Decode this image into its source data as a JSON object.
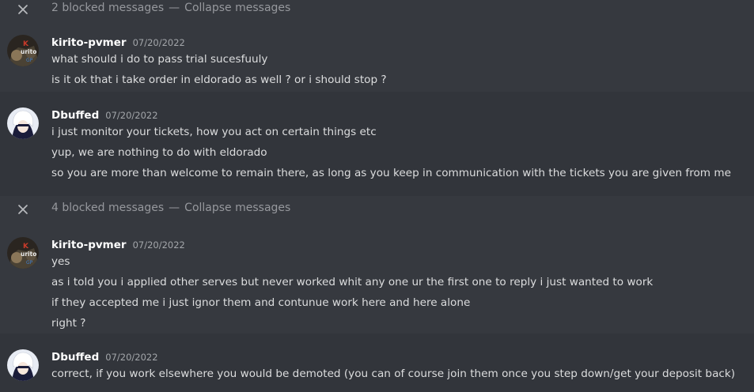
{
  "blocked_1": {
    "count_text": "2 blocked messages",
    "separator": "—",
    "collapse_label": "Collapse messages"
  },
  "group_1": {
    "username": "kirito-pvmer",
    "timestamp": "07/20/2022",
    "avatar_text": "K urito",
    "lines": [
      "what  should i do to pass trial sucesfuuly",
      "is it ok that i take order in eldorado as well ? or i should stop ?"
    ]
  },
  "group_2": {
    "username": "Dbuffed",
    "timestamp": "07/20/2022",
    "lines": [
      "i just monitor your tickets, how you act on certain things etc",
      "yup, we are nothing to do with eldorado",
      "so you are more than welcome to remain there, as long as you keep in communication with the tickets you are given from me"
    ]
  },
  "blocked_2": {
    "count_text": "4 blocked messages",
    "separator": "—",
    "collapse_label": "Collapse messages"
  },
  "group_3": {
    "username": "kirito-pvmer",
    "timestamp": "07/20/2022",
    "avatar_text": "K urito",
    "lines": [
      "yes",
      "as i told you i applied other serves but never worked whit any one ur the first one to reply i just wanted to work",
      "if they accepted me i just ignor them and contunue work here and here alone",
      "right ?"
    ]
  },
  "group_4": {
    "username": "Dbuffed",
    "timestamp": "07/20/2022",
    "lines": [
      "correct, if you work elsewhere you would be demoted (you can of course join them once you step down/get your deposit back)"
    ]
  },
  "colors": {
    "background": "#36393f",
    "hover_background": "#32353b",
    "text": "#dcddde",
    "muted": "#96989d",
    "username": "#ffffff"
  },
  "icons": {
    "blocked_close": "close-icon",
    "avatar_kirito": "kirito-avatar",
    "avatar_dbuffed": "anime-avatar"
  }
}
